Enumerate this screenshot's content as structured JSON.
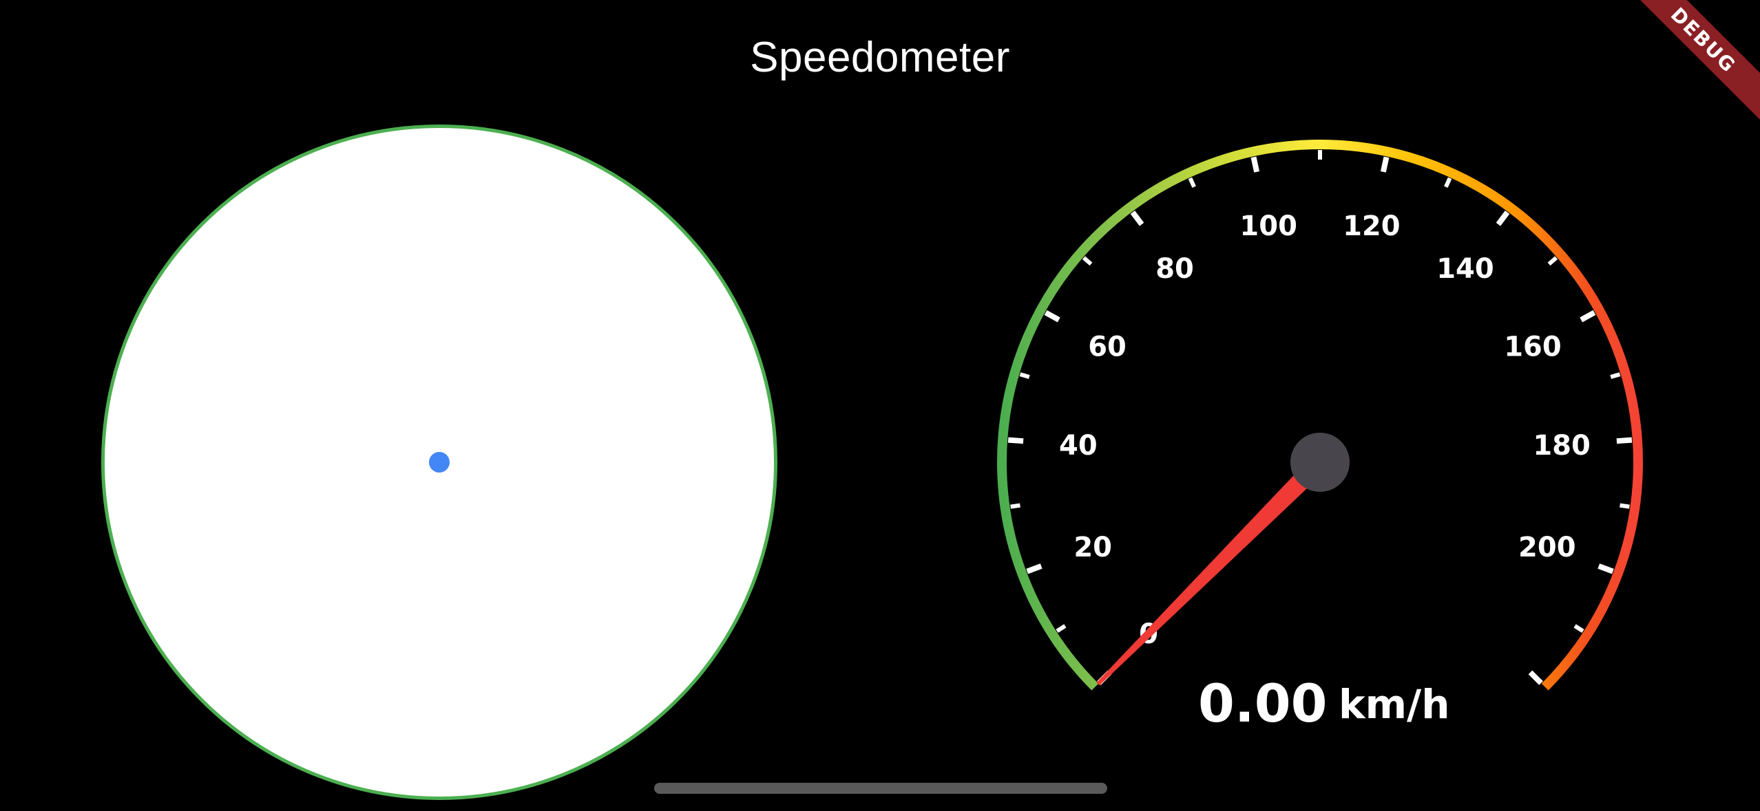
{
  "app": {
    "title": "Speedometer",
    "debug_label": "DEBUG"
  },
  "joystick": {
    "ring_color": "#4caf50",
    "dot_color": "#4287f5"
  },
  "speedometer": {
    "min": 0,
    "max": 220,
    "current_speed": 0,
    "speed_text": "0.00",
    "unit": "km/h",
    "tick_labels": [
      "0",
      "20",
      "40",
      "60",
      "80",
      "100",
      "120",
      "140",
      "160",
      "180",
      "200"
    ],
    "needle_color": "#f03a35",
    "hub_color": "#48464c",
    "arc_colors": [
      "#4cae4f",
      "#8bc34a",
      "#cddc39",
      "#ffeb3b",
      "#ffc107",
      "#ff9800",
      "#f4511e",
      "#f44336"
    ]
  }
}
